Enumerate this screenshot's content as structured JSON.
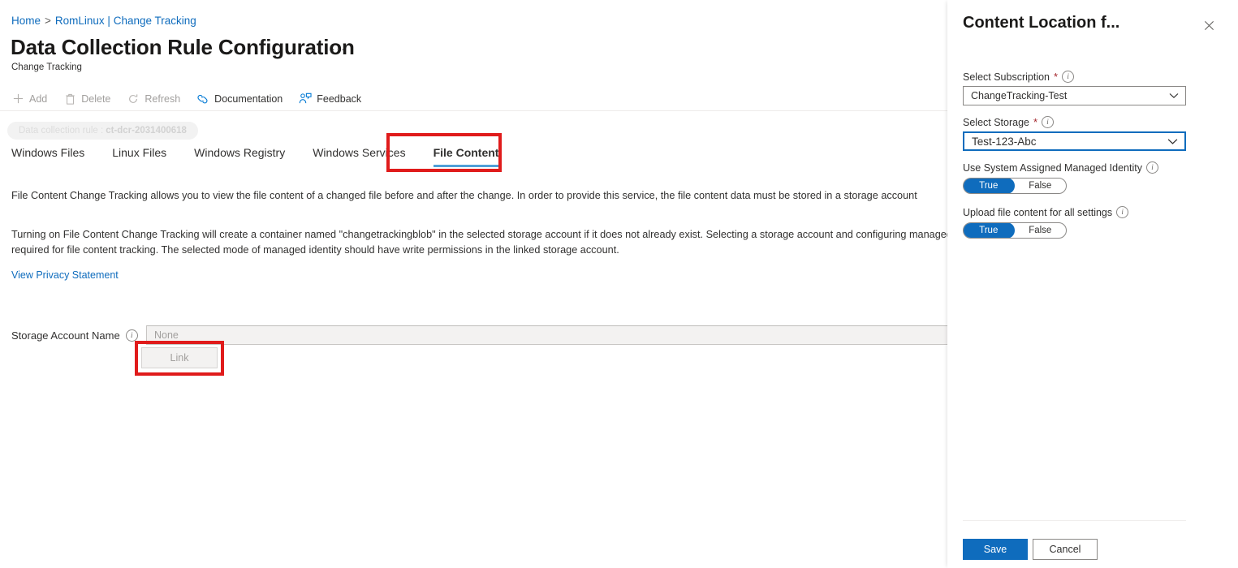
{
  "breadcrumb": {
    "home": "Home",
    "separator": ">",
    "current": "RomLinux | Change Tracking"
  },
  "header": {
    "title": "Data Collection Rule Configuration",
    "ellipsis": "···",
    "subtitle": "Change Tracking"
  },
  "command_bar": {
    "items": [
      {
        "label": "Add",
        "icon": "plus-icon",
        "enabled": false
      },
      {
        "label": "Delete",
        "icon": "trash-icon",
        "enabled": false
      },
      {
        "label": "Refresh",
        "icon": "refresh-icon",
        "enabled": false
      },
      {
        "label": "Documentation",
        "icon": "documentation-icon",
        "enabled": true
      },
      {
        "label": "Feedback",
        "icon": "feedback-icon",
        "enabled": true
      }
    ]
  },
  "scope_chip": {
    "prefix": "Data collection rule :",
    "value": "ct-dcr-2031400618"
  },
  "tabs": [
    {
      "label": "Windows Files",
      "active": false
    },
    {
      "label": "Linux Files",
      "active": false
    },
    {
      "label": "Windows Registry",
      "active": false
    },
    {
      "label": "Windows Services",
      "active": false
    },
    {
      "label": "File Content",
      "active": true
    }
  ],
  "content": {
    "paragraph_1": "File Content Change Tracking allows you to view the file content of a changed file before and after the change. In order to provide this service, the file content data must be stored in a storage account",
    "paragraph_2": "Turning on File Content Change Tracking will create a container named \"changetrackingblob\" in the selected storage account if it does not already exist. Selecting a storage account and configuring managed identity is required for file content tracking. The selected mode of managed identity should have write permissions in the linked storage account.",
    "privacy_link": "View Privacy Statement",
    "storage_account_label": "Storage Account Name",
    "storage_account_value": "None",
    "link_button": "Link"
  },
  "side_panel": {
    "title": "Content Location f...",
    "close_icon": "close-icon",
    "fields": {
      "subscription": {
        "label": "Select Subscription",
        "required": "*",
        "value": "ChangeTracking-Test"
      },
      "storage": {
        "label": "Select Storage",
        "required": "*",
        "value": "Test-123-Abc"
      },
      "managed_identity": {
        "label": "Use System Assigned Managed Identity",
        "on_label": "True",
        "off_label": "False",
        "selected": "True"
      },
      "upload_all": {
        "label": "Upload file content for all settings",
        "on_label": "True",
        "off_label": "False",
        "selected": "True"
      }
    },
    "footer": {
      "save": "Save",
      "cancel": "Cancel"
    }
  },
  "annotations": {
    "highlight_color": "#e01b1b",
    "boxes": [
      "file-content-tab",
      "link-button"
    ]
  },
  "colors": {
    "accent": "#0f6cbd",
    "tab_underline": "#4f9fd8",
    "link": "#0f6cbd",
    "required": "#a4262c"
  }
}
